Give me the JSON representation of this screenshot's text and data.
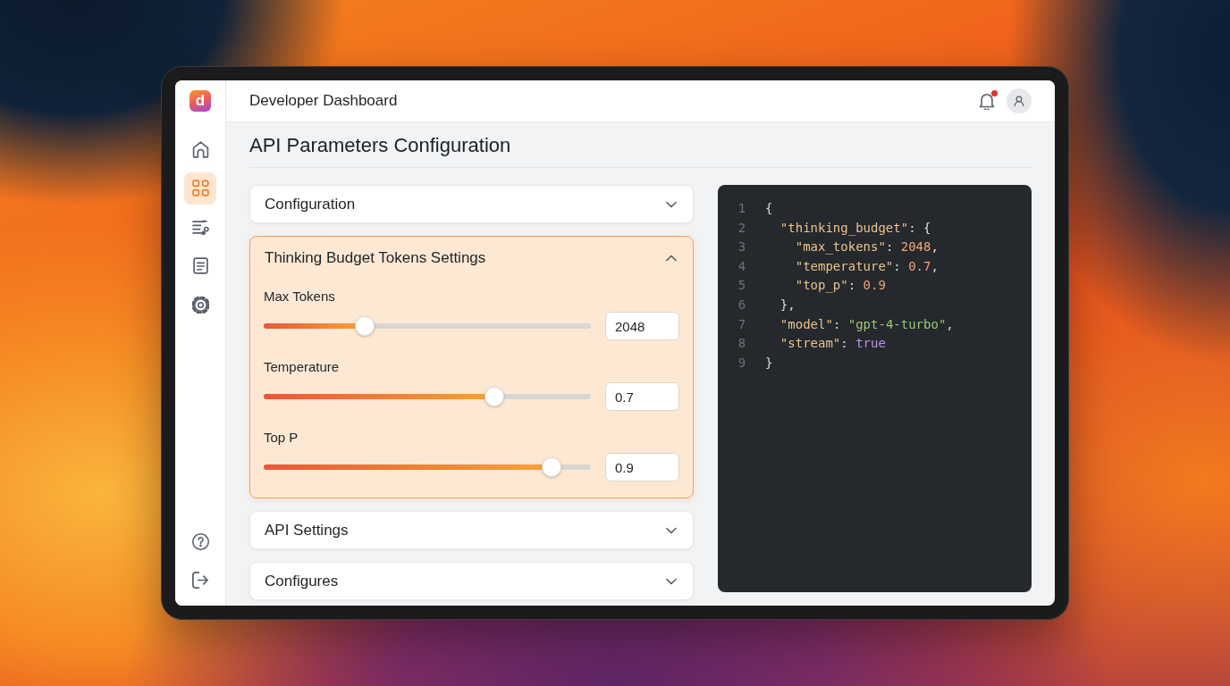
{
  "sidebar": {
    "logo": "d",
    "items": [
      {
        "selected": false
      },
      {
        "selected": true
      },
      {
        "selected": false
      },
      {
        "selected": false
      },
      {
        "selected": false
      }
    ]
  },
  "header": {
    "title": "Developer Dashboard",
    "unread": true
  },
  "page_title": "API Parameters Configuration",
  "accordions": [
    {
      "title": "Configuration",
      "expanded": false
    },
    {
      "title": "Thinking Budget Tokens Settings",
      "expanded": true,
      "parameters": [
        {
          "label": "Max Tokens",
          "level": 0.31,
          "value": "2048"
        },
        {
          "label": "Temperature",
          "level": 0.705,
          "value": "0.7"
        },
        {
          "label": "Top P",
          "level": 0.88,
          "value": "0.9"
        }
      ]
    },
    {
      "title": "API Settings",
      "expanded": false
    },
    {
      "title": "Configures",
      "expanded": false
    }
  ],
  "code_panel": {
    "lines": [
      {
        "number": "1",
        "tokens": [
          {
            "kind": "punct",
            "text": "{"
          }
        ]
      },
      {
        "number": "2",
        "tokens": [
          {
            "kind": "key",
            "text": "  \"thinking_budget\""
          },
          {
            "kind": "punct",
            "text": ": {"
          }
        ]
      },
      {
        "number": "3",
        "tokens": [
          {
            "kind": "key",
            "text": "    \"max_tokens\""
          },
          {
            "kind": "punct",
            "text": ": "
          },
          {
            "kind": "number",
            "text": "2048"
          },
          {
            "kind": "punct",
            "text": ","
          }
        ]
      },
      {
        "number": "4",
        "tokens": [
          {
            "kind": "key",
            "text": "    \"temperature\""
          },
          {
            "kind": "punct",
            "text": ": "
          },
          {
            "kind": "number",
            "text": "0.7"
          },
          {
            "kind": "punct",
            "text": ","
          }
        ]
      },
      {
        "number": "5",
        "tokens": [
          {
            "kind": "key",
            "text": "    \"top_p\""
          },
          {
            "kind": "punct",
            "text": ": "
          },
          {
            "kind": "number",
            "text": "0.9"
          }
        ]
      },
      {
        "number": "6",
        "tokens": [
          {
            "kind": "punct",
            "text": "  },"
          }
        ]
      },
      {
        "number": "7",
        "tokens": [
          {
            "kind": "key",
            "text": "  \"model\""
          },
          {
            "kind": "punct",
            "text": ": "
          },
          {
            "kind": "string",
            "text": "\"gpt-4-turbo\""
          },
          {
            "kind": "punct",
            "text": ","
          }
        ]
      },
      {
        "number": "8",
        "tokens": [
          {
            "kind": "key",
            "text": "  \"stream\""
          },
          {
            "kind": "punct",
            "text": ": "
          },
          {
            "kind": "boolean",
            "text": "true"
          }
        ]
      },
      {
        "number": "9",
        "tokens": [
          {
            "kind": "punct",
            "text": "}"
          }
        ]
      }
    ]
  }
}
